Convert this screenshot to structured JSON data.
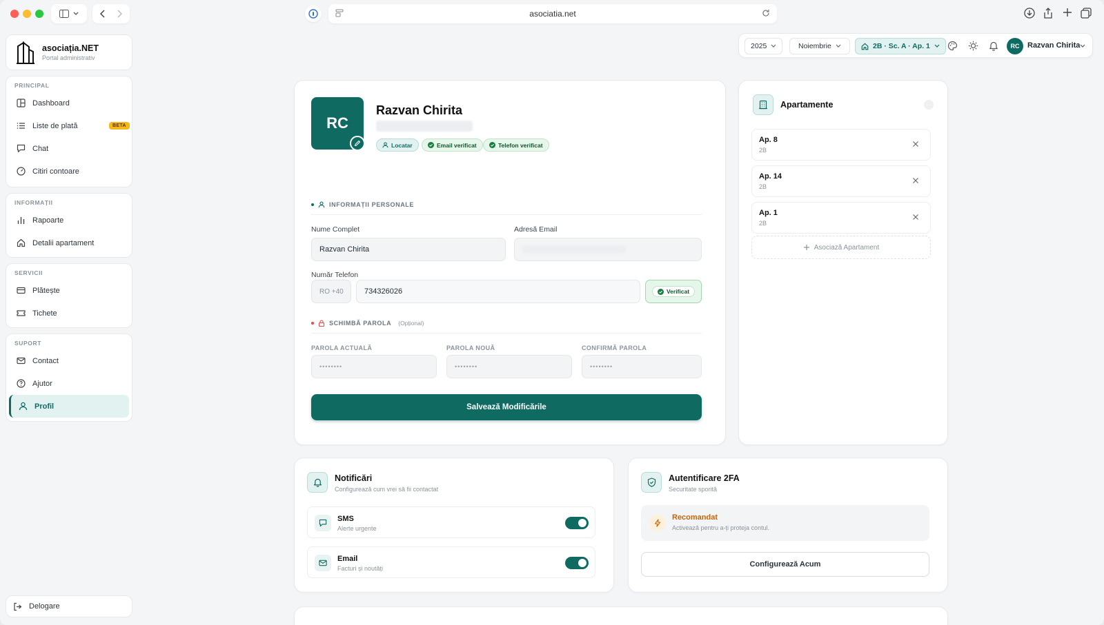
{
  "browser": {
    "url": "asociatia.net"
  },
  "brand": {
    "name": "asociația.NET",
    "subtitle": "Portal administrativ"
  },
  "sidebar": {
    "groups": [
      {
        "title": "PRINCIPAL",
        "items": [
          {
            "label": "Dashboard",
            "icon": "dashboard-icon"
          },
          {
            "label": "Liste de plată",
            "icon": "list-icon",
            "badge": "BETA"
          },
          {
            "label": "Chat",
            "icon": "chat-icon"
          },
          {
            "label": "Citiri contoare",
            "icon": "meter-icon"
          }
        ]
      },
      {
        "title": "INFORMAȚII",
        "items": [
          {
            "label": "Rapoarte",
            "icon": "chart-icon"
          },
          {
            "label": "Detalii apartament",
            "icon": "home-icon"
          }
        ]
      },
      {
        "title": "SERVICII",
        "items": [
          {
            "label": "Plătește",
            "icon": "card-icon"
          },
          {
            "label": "Tichete",
            "icon": "ticket-icon"
          }
        ]
      },
      {
        "title": "SUPORT",
        "items": [
          {
            "label": "Contact",
            "icon": "mail-icon"
          },
          {
            "label": "Ajutor",
            "icon": "help-icon"
          },
          {
            "label": "Profil",
            "icon": "user-icon",
            "active": true
          }
        ]
      }
    ],
    "logout": "Delogare"
  },
  "topbar": {
    "year": "2025",
    "month": "Noiembrie",
    "apartment": "2B · Sc. A · Ap. 1",
    "user_initials": "RC",
    "user_name": "Razvan Chirita"
  },
  "profile": {
    "initials": "RC",
    "name": "Razvan Chirita",
    "badges": [
      "Locatar",
      "Email verificat",
      "Telefon verificat"
    ],
    "personal_section": "INFORMAȚII PERSONALE",
    "full_name_label": "Nume Complet",
    "full_name_value": "Razvan Chirita",
    "email_label": "Adresă Email",
    "phone_label": "Număr Telefon",
    "phone_prefix": "RO +40",
    "phone_value": "734326026",
    "phone_status": "Verificat",
    "password_section": "SCHIMBĂ PAROLA",
    "password_optional": "(Opțional)",
    "current_password_label": "PAROLA ACTUALĂ",
    "new_password_label": "PAROLA NOUĂ",
    "confirm_password_label": "CONFIRMĂ PAROLA",
    "password_placeholder": "••••••••",
    "save_label": "Salvează Modificările"
  },
  "apartments": {
    "title": "Apartamente",
    "items": [
      {
        "name": "Ap. 8",
        "building": "2B"
      },
      {
        "name": "Ap. 14",
        "building": "2B"
      },
      {
        "name": "Ap. 1",
        "building": "2B"
      }
    ],
    "associate_label": "Asociază Apartament"
  },
  "notifications": {
    "title": "Notificări",
    "subtitle": "Configurează cum vrei să fii contactat",
    "items": [
      {
        "title": "SMS",
        "subtitle": "Alerte urgente",
        "enabled": true
      },
      {
        "title": "Email",
        "subtitle": "Facturi și noutăți",
        "enabled": true
      }
    ]
  },
  "twofa": {
    "title": "Autentificare 2FA",
    "subtitle": "Securitate sporită",
    "rec_title": "Recomandat",
    "rec_subtitle": "Activează pentru a-ți proteja contul.",
    "configure_label": "Configurează Acum"
  },
  "colors": {
    "accent": "#0f6b61",
    "accent_light": "#e2f2f1",
    "warning": "#c2670c",
    "beta": "#f5b81b"
  }
}
